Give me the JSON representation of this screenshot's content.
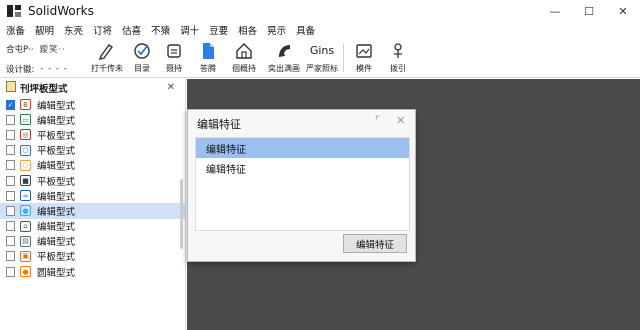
{
  "app": {
    "title": "SolidWorks"
  },
  "window_controls": {
    "minimize": "—",
    "maximize": "☐",
    "close": "✕"
  },
  "menu": [
    "涨备",
    "靓明",
    "东亮",
    "订将",
    "估喜",
    "不猿",
    "调十",
    "豆要",
    "相各",
    "晃示",
    "具备"
  ],
  "toolbar": {
    "left_rows": [
      {
        "label": "合屯P··",
        "value": "鑀笑··"
      },
      {
        "label": "设计徽:",
        "value": "- - - -"
      }
    ],
    "buttons": [
      {
        "label": "",
        "icon": "pen-icon"
      },
      {
        "label": "打千传未",
        "icon": "brush-icon"
      },
      {
        "label": "目录",
        "icon": "check-circle-icon"
      },
      {
        "label": "聂持",
        "icon": "printer-icon"
      },
      {
        "label": "答腾",
        "icon": "document-icon"
      },
      {
        "label": "徊概持",
        "icon": "home-icon"
      },
      {
        "label": "奕出满画",
        "icon": "phone-icon"
      },
      {
        "label": "严家照标",
        "icon": "gins-text-icon",
        "glyph": "Gins"
      },
      {
        "label": "模件",
        "icon": "image-icon"
      },
      {
        "label": "拨引",
        "icon": "gauge-icon"
      }
    ]
  },
  "panel": {
    "title": "刊坪板型式",
    "close": "✕",
    "items": [
      {
        "label": "编辑型式",
        "checked": true,
        "glyph": "B",
        "color": "#c0392b"
      },
      {
        "label": "编辑型式",
        "checked": false,
        "glyph": "▭",
        "color": "#2e7d32"
      },
      {
        "label": "平板型式",
        "checked": false,
        "glyph": "◎",
        "color": "#c62828"
      },
      {
        "label": "平板型式",
        "checked": false,
        "glyph": "○",
        "color": "#1976d2"
      },
      {
        "label": "编辑型式",
        "checked": false,
        "glyph": "○",
        "color": "#e6a23c"
      },
      {
        "label": "平板型式",
        "checked": false,
        "glyph": "■",
        "color": "#37474f"
      },
      {
        "label": "编辑型式",
        "checked": false,
        "glyph": "≈",
        "color": "#1565c0"
      },
      {
        "label": "编辑型式",
        "checked": false,
        "glyph": "●",
        "color": "#29b6f6",
        "selected": true
      },
      {
        "label": "编辑型式",
        "checked": false,
        "glyph": "⌂",
        "color": "#455a64"
      },
      {
        "label": "编辑型式",
        "checked": false,
        "glyph": "▤",
        "color": "#546e7a"
      },
      {
        "label": "平板型式",
        "checked": false,
        "glyph": "▣",
        "color": "#ef6c00"
      },
      {
        "label": "圆辑型式",
        "checked": false,
        "glyph": "●",
        "color": "#f57c00"
      }
    ]
  },
  "dialog": {
    "title": "编辑特征",
    "restore": "⌜",
    "close": "✕",
    "list": [
      "编辑特征",
      "编辑特征"
    ],
    "selected_index": 0,
    "button": "编辑特征"
  },
  "colors": {
    "canvas": "#4b4b4b",
    "selection": "#9cc0ee",
    "tree_selection": "#cfe0f7",
    "accent": "#2b6fd6"
  }
}
